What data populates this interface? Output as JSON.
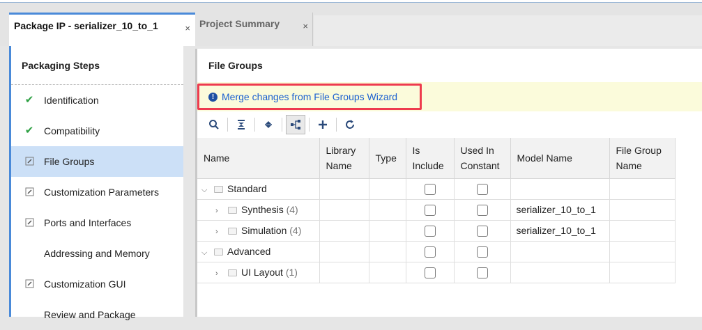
{
  "tabs": [
    {
      "label": "Package IP - serializer_10_to_1",
      "close": "×"
    },
    {
      "label": "Project Summary",
      "close": "×"
    }
  ],
  "left": {
    "title": "Packaging Steps",
    "steps": [
      {
        "label": "Identification",
        "icon": "check-icon"
      },
      {
        "label": "Compatibility",
        "icon": "check-icon"
      },
      {
        "label": "File Groups",
        "icon": "edit-icon"
      },
      {
        "label": "Customization Parameters",
        "icon": "edit-icon"
      },
      {
        "label": "Ports and Interfaces",
        "icon": "edit-icon"
      },
      {
        "label": "Addressing and Memory",
        "icon": ""
      },
      {
        "label": "Customization GUI",
        "icon": "edit-icon"
      },
      {
        "label": "Review and Package",
        "icon": ""
      }
    ]
  },
  "main": {
    "title": "File Groups",
    "merge_link": "Merge changes from File Groups Wizard",
    "columns": [
      "Name",
      "Library Name",
      "Type",
      "Is Include",
      "Used In Constant",
      "Model Name",
      "File Group Name"
    ],
    "rows": [
      {
        "name": "Standard",
        "count": "",
        "model": ""
      },
      {
        "name": "Synthesis",
        "count": "(4)",
        "model": "serializer_10_to_1"
      },
      {
        "name": "Simulation",
        "count": "(4)",
        "model": "serializer_10_to_1"
      },
      {
        "name": "Advanced",
        "count": "",
        "model": ""
      },
      {
        "name": "UI Layout",
        "count": "(1)",
        "model": ""
      }
    ]
  },
  "colors": {
    "accent": "#4a8ad9",
    "selected": "#cce0f7",
    "highlight_border": "#ee3b4e",
    "banner": "#fbfbdb"
  }
}
